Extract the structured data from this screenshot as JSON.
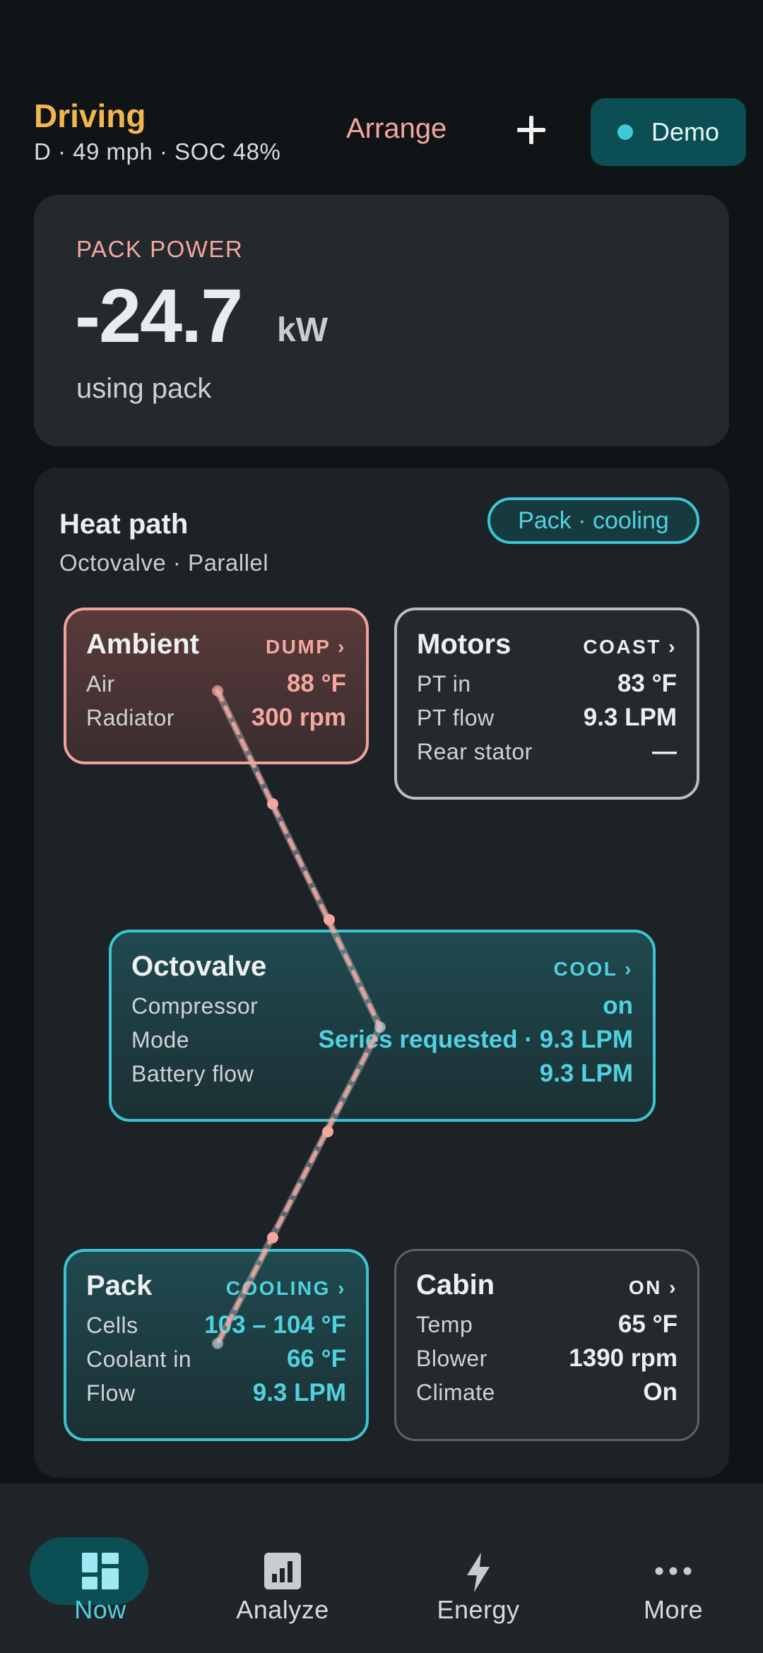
{
  "header": {
    "title": "Driving",
    "subtitle": "D · 49 mph · SOC 48%",
    "arrange_label": "Arrange",
    "demo_label": "Demo"
  },
  "power": {
    "label": "PACK POWER",
    "value": "-24.7",
    "unit": "kW",
    "description": "using pack"
  },
  "heat": {
    "title": "Heat path",
    "subtitle": "Octovalve · Parallel",
    "badge": "Pack · cooling",
    "ambient": {
      "name": "Ambient",
      "mode": "DUMP ›",
      "rows": [
        {
          "k": "Air",
          "v": "88 °F"
        },
        {
          "k": "Radiator",
          "v": "300 rpm"
        }
      ]
    },
    "motors": {
      "name": "Motors",
      "mode": "COAST ›",
      "rows": [
        {
          "k": "PT in",
          "v": "83 °F"
        },
        {
          "k": "PT flow",
          "v": "9.3 LPM"
        },
        {
          "k": "Rear stator",
          "v": "—"
        }
      ]
    },
    "octovalve": {
      "name": "Octovalve",
      "mode": "COOL ›",
      "rows": [
        {
          "k": "Compressor",
          "v": "on"
        },
        {
          "k": "Mode",
          "v": "Series requested · 9.3 LPM"
        },
        {
          "k": "Battery flow",
          "v": "9.3 LPM"
        }
      ]
    },
    "pack": {
      "name": "Pack",
      "mode": "COOLING ›",
      "rows": [
        {
          "k": "Cells",
          "v": "103 – 104 °F"
        },
        {
          "k": "Coolant in",
          "v": "66 °F"
        },
        {
          "k": "Flow",
          "v": "9.3 LPM"
        }
      ]
    },
    "cabin": {
      "name": "Cabin",
      "mode": "ON ›",
      "rows": [
        {
          "k": "Temp",
          "v": "65 °F"
        },
        {
          "k": "Blower",
          "v": "1390 rpm"
        },
        {
          "k": "Climate",
          "v": "On"
        }
      ]
    }
  },
  "nav": {
    "items": [
      {
        "label": "Now"
      },
      {
        "label": "Analyze"
      },
      {
        "label": "Energy"
      },
      {
        "label": "More"
      }
    ]
  },
  "colors": {
    "accent_teal": "#4fd2e0",
    "accent_salmon": "#f4a79e",
    "accent_amber": "#f2b64f",
    "background": "#101417"
  }
}
